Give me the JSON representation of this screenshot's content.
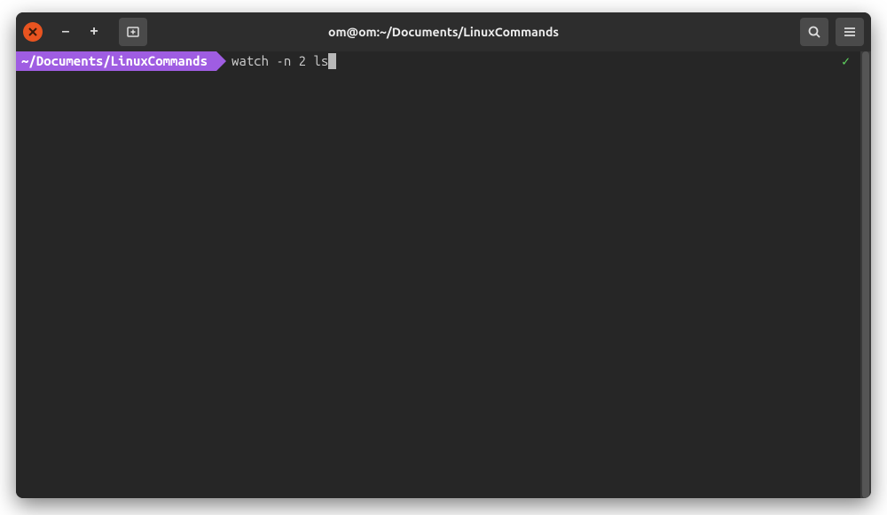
{
  "window": {
    "title": "om@om:~/Documents/LinuxCommands"
  },
  "prompt": {
    "path": "~/Documents/LinuxCommands",
    "command": "watch -n 2 ls",
    "status_indicator": "✓"
  },
  "colors": {
    "prompt_bg": "#9f5de2",
    "close_btn": "#e95420",
    "status_ok": "#5fd35f",
    "terminal_bg": "#262626"
  }
}
